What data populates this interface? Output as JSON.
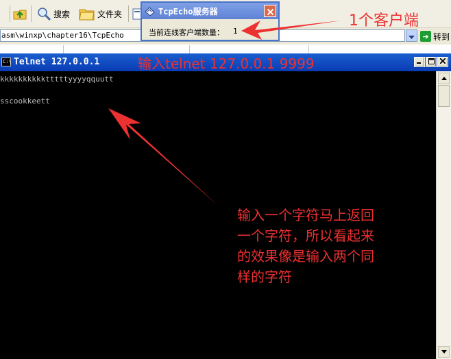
{
  "explorer": {
    "toolbar": {
      "search_label": "搜索",
      "folders_label": "文件夹"
    },
    "address": {
      "path": "asm\\winxp\\chapter16\\TcpEcho",
      "go_label": "转到"
    }
  },
  "telnet": {
    "title": "Telnet 127.0.0.1",
    "icon_text": "C:\\",
    "lines": [
      "kkkkkkkkkktttttyyyyqquutt",
      "sscookkeett"
    ]
  },
  "tcp_server": {
    "title": "TcpEcho服务器",
    "label": "当前连线客户端数量：",
    "count": "1"
  },
  "annotations": {
    "client_count": "1个客户端",
    "command": "输入telnet 127.0.0.1 9999",
    "explain": [
      "输入一个字符马上返回",
      "一个字符，所以看起来",
      "的效果像是输入两个同",
      "样的字符"
    ],
    "color": "#EC3131"
  },
  "colors": {
    "telnet_title_bg": "#0A3CB4",
    "console_bg": "#000000",
    "console_text": "#C0C0C0",
    "tcp_title_bg": "#6F91DE"
  }
}
